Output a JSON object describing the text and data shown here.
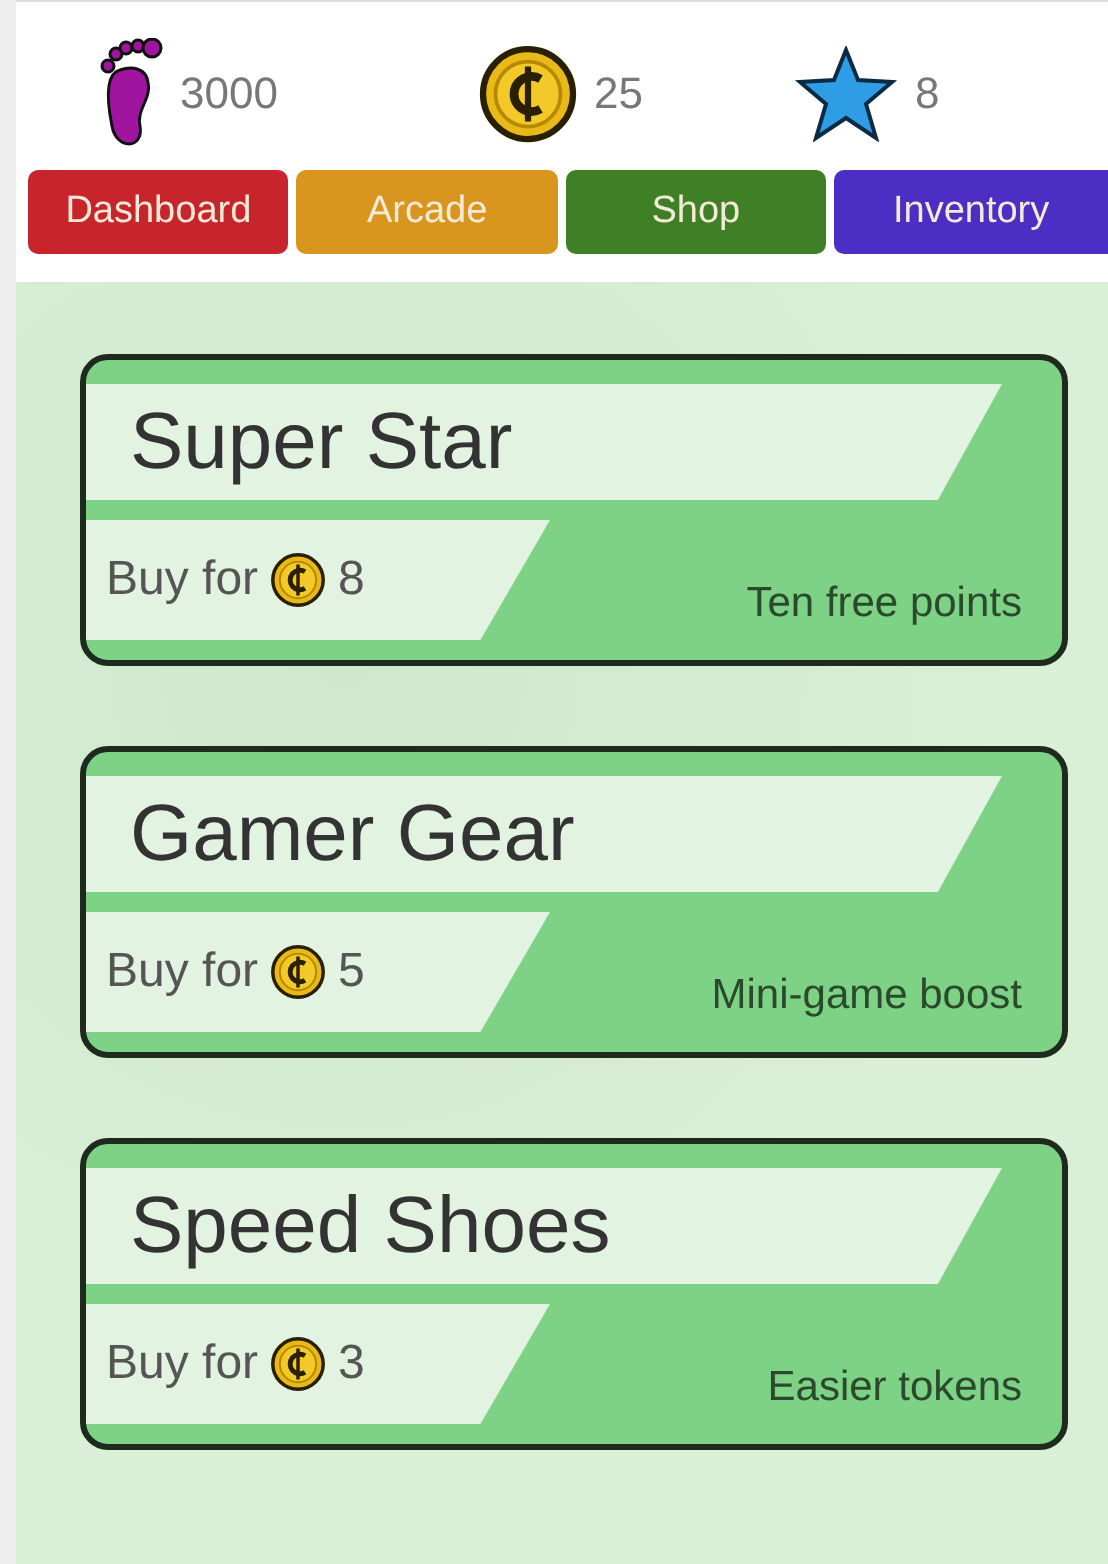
{
  "stats": [
    {
      "kind": "steps",
      "value": "3000"
    },
    {
      "kind": "coins",
      "value": "25"
    },
    {
      "kind": "stars",
      "value": "8"
    }
  ],
  "tabs": [
    {
      "label": "Dashboard",
      "color": "#c8242b"
    },
    {
      "label": "Arcade",
      "color": "#d8961e"
    },
    {
      "label": "Shop",
      "color": "#3f7f25"
    },
    {
      "label": "Inventory",
      "color": "#4b2fc4"
    }
  ],
  "items": [
    {
      "name": "Super Star",
      "buy_label": "Buy for",
      "price": "8",
      "description": "Ten free points"
    },
    {
      "name": "Gamer Gear",
      "buy_label": "Buy for",
      "price": "5",
      "description": "Mini-game boost"
    },
    {
      "name": "Speed Shoes",
      "buy_label": "Buy for",
      "price": "3",
      "description": "Easier tokens"
    }
  ]
}
